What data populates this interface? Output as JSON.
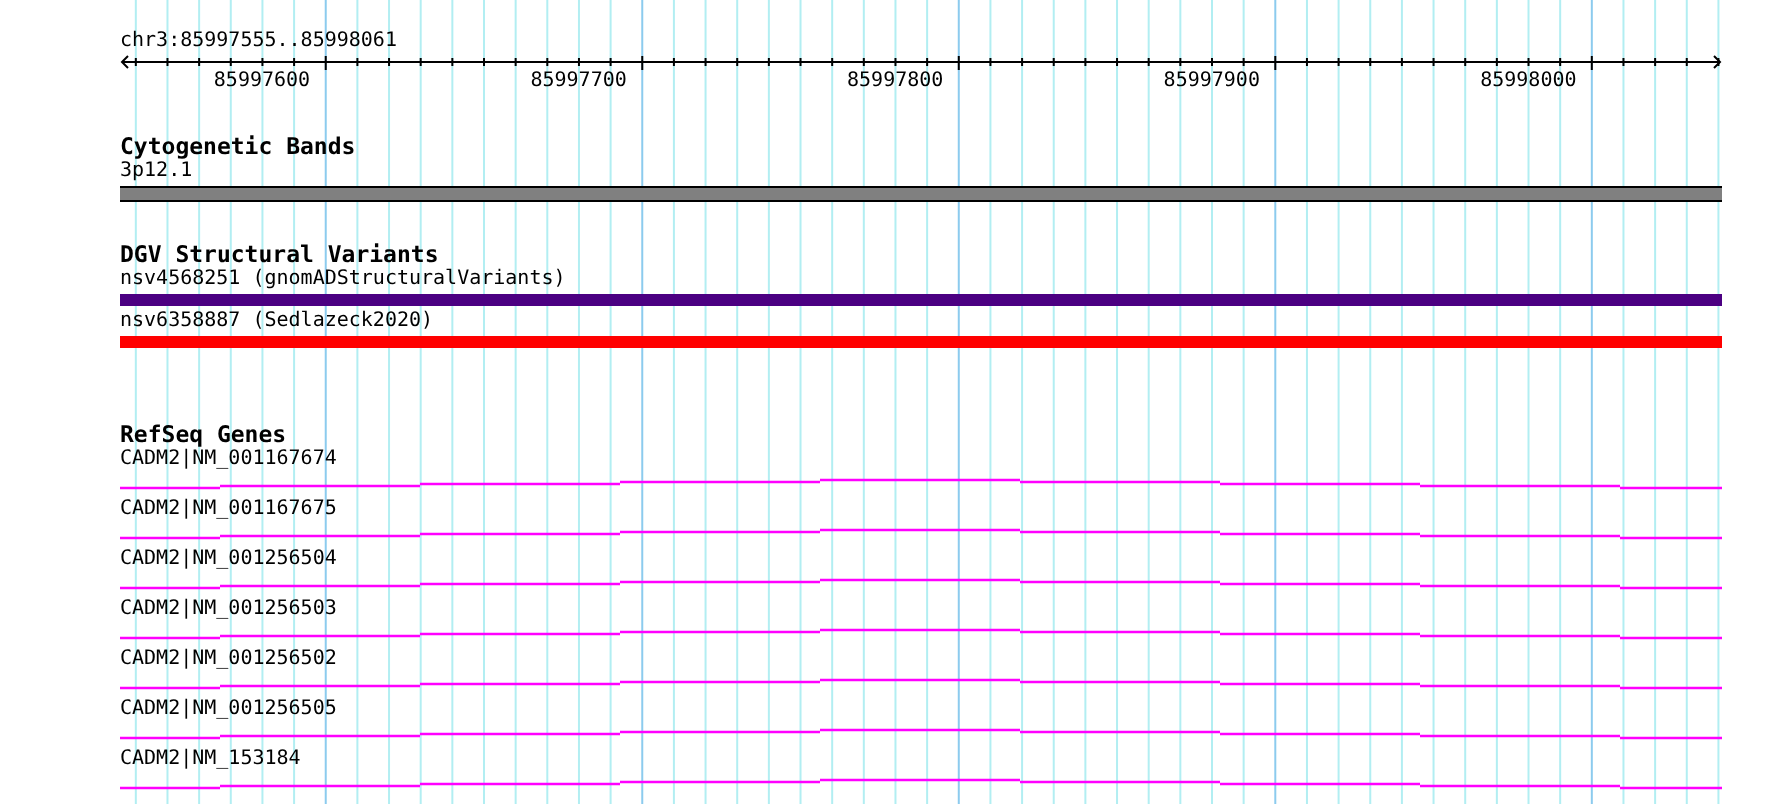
{
  "ruler": {
    "region": "chr3:85997555..85998061",
    "ticks": [
      "85997600",
      "85997700",
      "85997800",
      "85997900",
      "85998000"
    ]
  },
  "tracks": [
    {
      "kind": "band",
      "title": "Cytogenetic Bands",
      "features": [
        {
          "label": "3p12.1",
          "color": "#808080"
        }
      ]
    },
    {
      "kind": "variant",
      "title": "DGV Structural Variants",
      "features": [
        {
          "label": "nsv4568251 (gnomADStructuralVariants)",
          "color": "#4b0082"
        },
        {
          "label": "nsv6358887 (Sedlazeck2020)",
          "color": "#ff0000"
        }
      ]
    },
    {
      "kind": "gene",
      "title": "RefSeq Genes",
      "features": [
        {
          "label": "CADM2|NM_001167674",
          "color": "#ff00ff"
        },
        {
          "label": "CADM2|NM_001167675",
          "color": "#ff00ff"
        },
        {
          "label": "CADM2|NM_001256504",
          "color": "#ff00ff"
        },
        {
          "label": "CADM2|NM_001256503",
          "color": "#ff00ff"
        },
        {
          "label": "CADM2|NM_001256502",
          "color": "#ff00ff"
        },
        {
          "label": "CADM2|NM_001256505",
          "color": "#ff00ff"
        },
        {
          "label": "CADM2|NM_153184",
          "color": "#ff00ff"
        }
      ]
    }
  ]
}
